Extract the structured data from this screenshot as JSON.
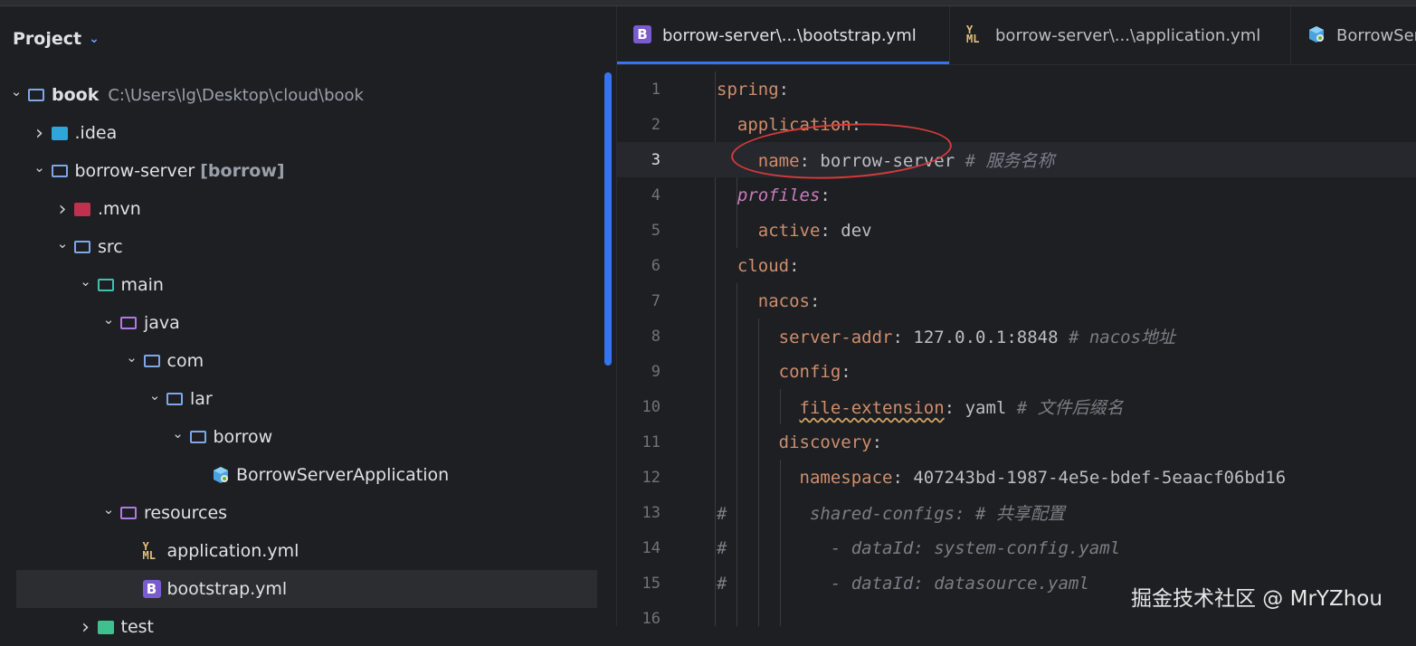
{
  "project_panel": {
    "title": "Project",
    "tree": [
      {
        "label": "book",
        "suffix": "C:\\Users\\lg\\Desktop\\cloud\\book",
        "depth": 0,
        "arrow": "expanded",
        "icon": "folder-icon"
      },
      {
        "label": ".idea",
        "depth": 1,
        "arrow": "collapsed",
        "icon": "idea-folder-icon"
      },
      {
        "label": "borrow-server",
        "suffix": "[borrow]",
        "depth": 1,
        "arrow": "expanded",
        "icon": "module-folder-icon"
      },
      {
        "label": ".mvn",
        "depth": 2,
        "arrow": "collapsed",
        "icon": "mvn-folder-icon"
      },
      {
        "label": "src",
        "depth": 2,
        "arrow": "expanded",
        "icon": "source-folder-icon"
      },
      {
        "label": "main",
        "depth": 3,
        "arrow": "expanded",
        "icon": "main-folder-icon"
      },
      {
        "label": "java",
        "depth": 4,
        "arrow": "expanded",
        "icon": "java-folder-icon"
      },
      {
        "label": "com",
        "depth": 5,
        "arrow": "expanded",
        "icon": "package-folder-icon"
      },
      {
        "label": "lar",
        "depth": 6,
        "arrow": "expanded",
        "icon": "package-folder-icon"
      },
      {
        "label": "borrow",
        "depth": 7,
        "arrow": "expanded",
        "icon": "package-folder-icon"
      },
      {
        "label": "BorrowServerApplication",
        "depth": 8,
        "arrow": "none",
        "icon": "spring-boot-class-icon"
      },
      {
        "label": "resources",
        "depth": 4,
        "arrow": "expanded",
        "icon": "resources-folder-icon"
      },
      {
        "label": "application.yml",
        "depth": 5,
        "arrow": "none",
        "icon": "yaml-file-icon"
      },
      {
        "label": "bootstrap.yml",
        "depth": 5,
        "arrow": "none",
        "icon": "bootstrap-file-icon",
        "selected": true
      },
      {
        "label": "test",
        "depth": 3,
        "arrow": "collapsed",
        "icon": "test-folder-icon"
      }
    ]
  },
  "editor": {
    "tabs": [
      {
        "label": "borrow-server\\...\\bootstrap.yml",
        "active": true,
        "modified": true,
        "icon": "bootstrap-file-icon"
      },
      {
        "label": "borrow-server\\...\\application.yml",
        "active": false,
        "icon": "yaml-file-icon"
      },
      {
        "label": "BorrowServerApplication",
        "active": false,
        "icon": "spring-boot-class-icon"
      }
    ],
    "lines": [
      {
        "n": "1",
        "tokens": [
          [
            "k",
            "spring"
          ],
          [
            "p",
            ":"
          ]
        ]
      },
      {
        "n": "2",
        "tokens": [
          [
            "p",
            "  "
          ],
          [
            "k",
            "application"
          ],
          [
            "p",
            ":"
          ]
        ]
      },
      {
        "n": "3",
        "tokens": [
          [
            "p",
            "    "
          ],
          [
            "k",
            "name"
          ],
          [
            "p",
            ": "
          ],
          [
            "v",
            "borrow-server "
          ],
          [
            "c",
            "# 服务名称"
          ]
        ],
        "current": true
      },
      {
        "n": "4",
        "tokens": [
          [
            "p",
            "  "
          ],
          [
            "k2",
            "profiles"
          ],
          [
            "p",
            ":"
          ]
        ]
      },
      {
        "n": "5",
        "tokens": [
          [
            "p",
            "    "
          ],
          [
            "k",
            "active"
          ],
          [
            "p",
            ": "
          ],
          [
            "v",
            "dev"
          ]
        ]
      },
      {
        "n": "6",
        "tokens": [
          [
            "p",
            "  "
          ],
          [
            "k",
            "cloud"
          ],
          [
            "p",
            ":"
          ]
        ]
      },
      {
        "n": "7",
        "tokens": [
          [
            "p",
            "    "
          ],
          [
            "k",
            "nacos"
          ],
          [
            "p",
            ":"
          ]
        ]
      },
      {
        "n": "8",
        "tokens": [
          [
            "p",
            "      "
          ],
          [
            "k",
            "server-addr"
          ],
          [
            "p",
            ": "
          ],
          [
            "v",
            "127.0.0.1:8848 "
          ],
          [
            "c",
            "# nacos地址"
          ]
        ]
      },
      {
        "n": "9",
        "tokens": [
          [
            "p",
            "      "
          ],
          [
            "k",
            "config"
          ],
          [
            "p",
            ":"
          ]
        ]
      },
      {
        "n": "10",
        "tokens": [
          [
            "p",
            "        "
          ],
          [
            "ku",
            "file-extension"
          ],
          [
            "p",
            ": "
          ],
          [
            "v",
            "yaml "
          ],
          [
            "c",
            "# 文件后缀名"
          ]
        ]
      },
      {
        "n": "11",
        "tokens": [
          [
            "p",
            "      "
          ],
          [
            "k",
            "discovery"
          ],
          [
            "p",
            ":"
          ]
        ]
      },
      {
        "n": "12",
        "tokens": [
          [
            "p",
            "        "
          ],
          [
            "k",
            "namespace"
          ],
          [
            "p",
            ": "
          ],
          [
            "v",
            "407243bd-1987-4e5e-bdef-5eaacf06bd16"
          ]
        ]
      },
      {
        "n": "13",
        "tokens": [
          [
            "c",
            "#        shared-configs: # 共享配置"
          ]
        ]
      },
      {
        "n": "14",
        "tokens": [
          [
            "c",
            "#          - dataId: system-config.yaml"
          ]
        ]
      },
      {
        "n": "15",
        "tokens": [
          [
            "c",
            "#          - dataId: datasource.yaml"
          ]
        ]
      },
      {
        "n": "16",
        "tokens": []
      }
    ]
  },
  "watermark": "掘金技术社区 @ MrYZhou",
  "colors": {
    "accent": "#3574f0",
    "annotation": "#d63a3a",
    "key": "#cf8e6d",
    "comment": "#7a7e85"
  }
}
